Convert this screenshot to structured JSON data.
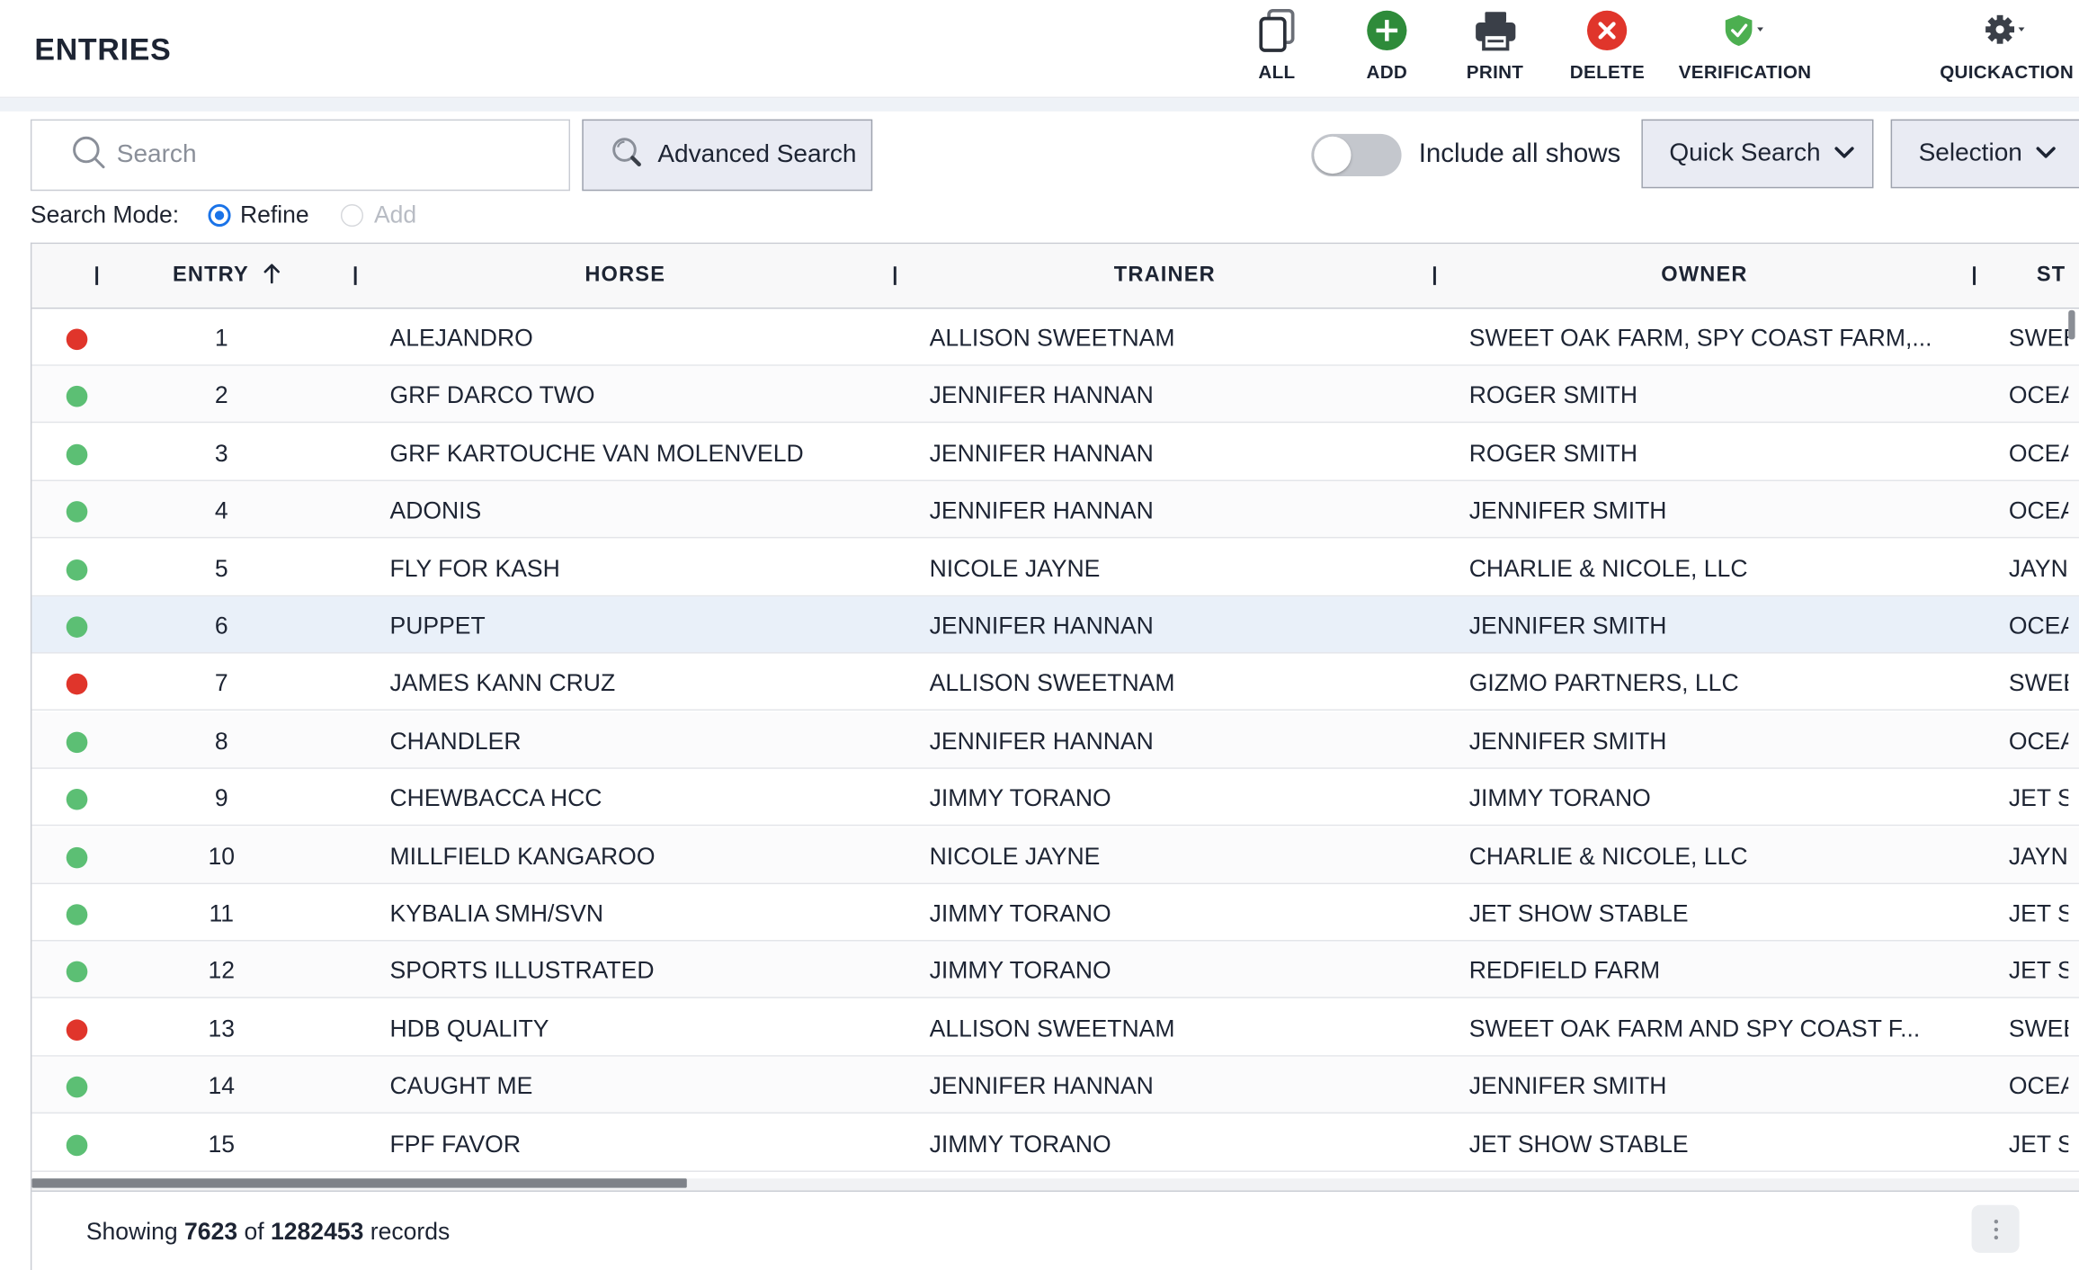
{
  "header": {
    "title": "ENTRIES",
    "actions": [
      {
        "label": "ALL",
        "icon": "copy-icon"
      },
      {
        "label": "ADD",
        "icon": "add-circle-icon",
        "color": "#2e8b3a"
      },
      {
        "label": "PRINT",
        "icon": "printer-icon"
      },
      {
        "label": "DELETE",
        "icon": "delete-circle-icon",
        "color": "#e0352b"
      },
      {
        "label": "VERIFICATION",
        "icon": "shield-check-icon",
        "color": "#4caf50"
      },
      {
        "label": "QUICKACTION",
        "icon": "gear-icon"
      }
    ]
  },
  "toolbar": {
    "search_placeholder": "Search",
    "advanced_search_label": "Advanced Search",
    "include_all_shows_label": "Include all shows",
    "include_all_shows_on": false,
    "quick_search_label": "Quick Search",
    "selection_label": "Selection",
    "search_mode_label": "Search Mode:",
    "mode_refine_label": "Refine",
    "mode_add_label": "Add",
    "selected_mode": "Refine"
  },
  "grid": {
    "columns": [
      "ENTRY",
      "HORSE",
      "TRAINER",
      "OWNER",
      "ST"
    ],
    "sort_column": "ENTRY",
    "sort_direction": "ascending",
    "status_colors": {
      "red": "#e0352b",
      "green": "#5cbf74"
    },
    "rows": [
      {
        "status": "red",
        "entry": "1",
        "horse": "ALEJANDRO",
        "trainer": "ALLISON SWEETNAM",
        "owner": "SWEET OAK FARM, SPY COAST FARM,...",
        "st": "SWEE"
      },
      {
        "status": "green",
        "entry": "2",
        "horse": "GRF DARCO TWO",
        "trainer": "JENNIFER HANNAN",
        "owner": "ROGER SMITH",
        "st": "OCEA"
      },
      {
        "status": "green",
        "entry": "3",
        "horse": "GRF KARTOUCHE VAN MOLENVELD",
        "trainer": "JENNIFER HANNAN",
        "owner": "ROGER SMITH",
        "st": "OCEA"
      },
      {
        "status": "green",
        "entry": "4",
        "horse": "ADONIS",
        "trainer": "JENNIFER HANNAN",
        "owner": "JENNIFER SMITH",
        "st": "OCEA"
      },
      {
        "status": "green",
        "entry": "5",
        "horse": "FLY FOR KASH",
        "trainer": "NICOLE JAYNE",
        "owner": "CHARLIE & NICOLE, LLC",
        "st": "JAYN"
      },
      {
        "status": "green",
        "entry": "6",
        "horse": "PUPPET",
        "trainer": "JENNIFER HANNAN",
        "owner": "JENNIFER SMITH",
        "st": "OCEA",
        "selected": true
      },
      {
        "status": "red",
        "entry": "7",
        "horse": "JAMES KANN CRUZ",
        "trainer": "ALLISON SWEETNAM",
        "owner": "GIZMO PARTNERS, LLC",
        "st": "SWEE"
      },
      {
        "status": "green",
        "entry": "8",
        "horse": "CHANDLER",
        "trainer": "JENNIFER HANNAN",
        "owner": "JENNIFER SMITH",
        "st": "OCEA"
      },
      {
        "status": "green",
        "entry": "9",
        "horse": "CHEWBACCA HCC",
        "trainer": "JIMMY TORANO",
        "owner": "JIMMY TORANO",
        "st": "JET S"
      },
      {
        "status": "green",
        "entry": "10",
        "horse": "MILLFIELD KANGAROO",
        "trainer": "NICOLE JAYNE",
        "owner": "CHARLIE & NICOLE, LLC",
        "st": "JAYN"
      },
      {
        "status": "green",
        "entry": "11",
        "horse": "KYBALIA SMH/SVN",
        "trainer": "JIMMY TORANO",
        "owner": "JET SHOW STABLE",
        "st": "JET S"
      },
      {
        "status": "green",
        "entry": "12",
        "horse": "SPORTS ILLUSTRATED",
        "trainer": "JIMMY TORANO",
        "owner": "REDFIELD FARM",
        "st": "JET S"
      },
      {
        "status": "red",
        "entry": "13",
        "horse": "HDB QUALITY",
        "trainer": "ALLISON SWEETNAM",
        "owner": "SWEET OAK FARM AND SPY COAST F...",
        "st": "SWEE"
      },
      {
        "status": "green",
        "entry": "14",
        "horse": "CAUGHT ME",
        "trainer": "JENNIFER HANNAN",
        "owner": "JENNIFER SMITH",
        "st": "OCEA"
      },
      {
        "status": "green",
        "entry": "15",
        "horse": "FPF FAVOR",
        "trainer": "JIMMY TORANO",
        "owner": "JET SHOW STABLE",
        "st": "JET S"
      }
    ]
  },
  "footer": {
    "prefix": "Showing",
    "shown": "7623",
    "middle": "of",
    "total": "1282453",
    "suffix": "records"
  }
}
